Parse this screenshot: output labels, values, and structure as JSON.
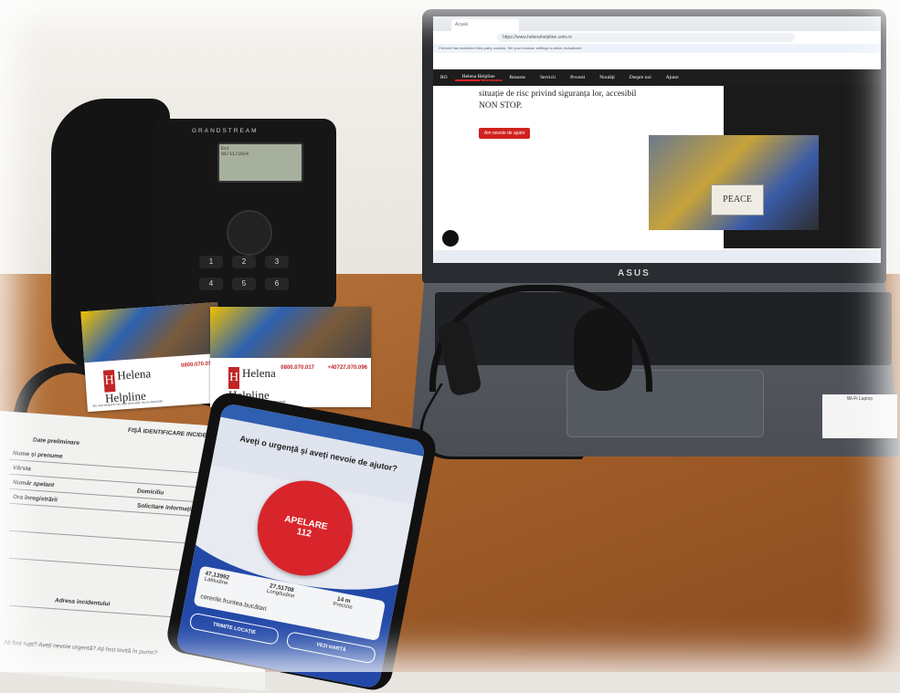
{
  "browser": {
    "tab_title": "Acasă",
    "url": "https://www.helenahelpline.com.ro",
    "notice": "Chrome has restricted third-party cookies. Set your browser settings to allow. Actualizare"
  },
  "site": {
    "lang": "RO",
    "nav": [
      "Helena Helpline",
      "Resurse",
      "Servicii",
      "Povesti",
      "Noutăți",
      "Despre noi",
      "Ajutor"
    ],
    "hero_text": "Serviciu suport oferit femeilor care se află într-o situație de risc privind siguranța lor, accesibil NON STOP.",
    "hero_button": "Am nevoie de ajutor",
    "photo_sign": "PEACE"
  },
  "laptop": {
    "brand": "ASUS",
    "sticker": "Wi-Fi Laptop"
  },
  "desk_phone": {
    "brand": "GRANDSTREAM",
    "lcd_line1": "Ext",
    "lcd_line2": "06/11/2024",
    "keys": [
      "1",
      "2",
      "3",
      "4",
      "5",
      "6"
    ]
  },
  "cards": [
    {
      "logo_line1": "Helena",
      "logo_line2": "Helpline",
      "number": "0800.070.017",
      "note": "Nu ești singură. Nu ești vinovată. Nu te ascunde."
    },
    {
      "logo_line1": "Helena",
      "logo_line2": "Helpline",
      "number": "0800.070.017",
      "number2": "+40727.070.096",
      "note": "Nu ești singură. Nu ești vinovată. Nu te ascunde."
    }
  ],
  "form": {
    "title": "FIȘĂ IDENTIFICARE INCIDENT",
    "section": "Date preliminare",
    "fields": [
      "Nume și prenume",
      "Vârsta",
      "Număr apelant",
      "Domiciliu",
      "Ora înregistrării",
      "Solicitare informații"
    ],
    "address_label": "Adresa incidentului",
    "footer": "Ați fost rupt? Aveți nevoie urgentă? Ați fost lovită în pumn?"
  },
  "smartphone": {
    "question": "Aveți o urgență și aveți nevoie de ajutor?",
    "button_line1": "APELARE",
    "button_line2": "112",
    "latitude": "47,13992",
    "latitude_label": "Latitudine",
    "longitude": "27,51708",
    "longitude_label": "Longitudine",
    "precision": "14 m",
    "precision_label": "Precizie",
    "address": "cererile.fruntea.bucătari",
    "share_button": "TRIMITE LOCAȚIE",
    "map_button": "VEZI HARTĂ"
  }
}
